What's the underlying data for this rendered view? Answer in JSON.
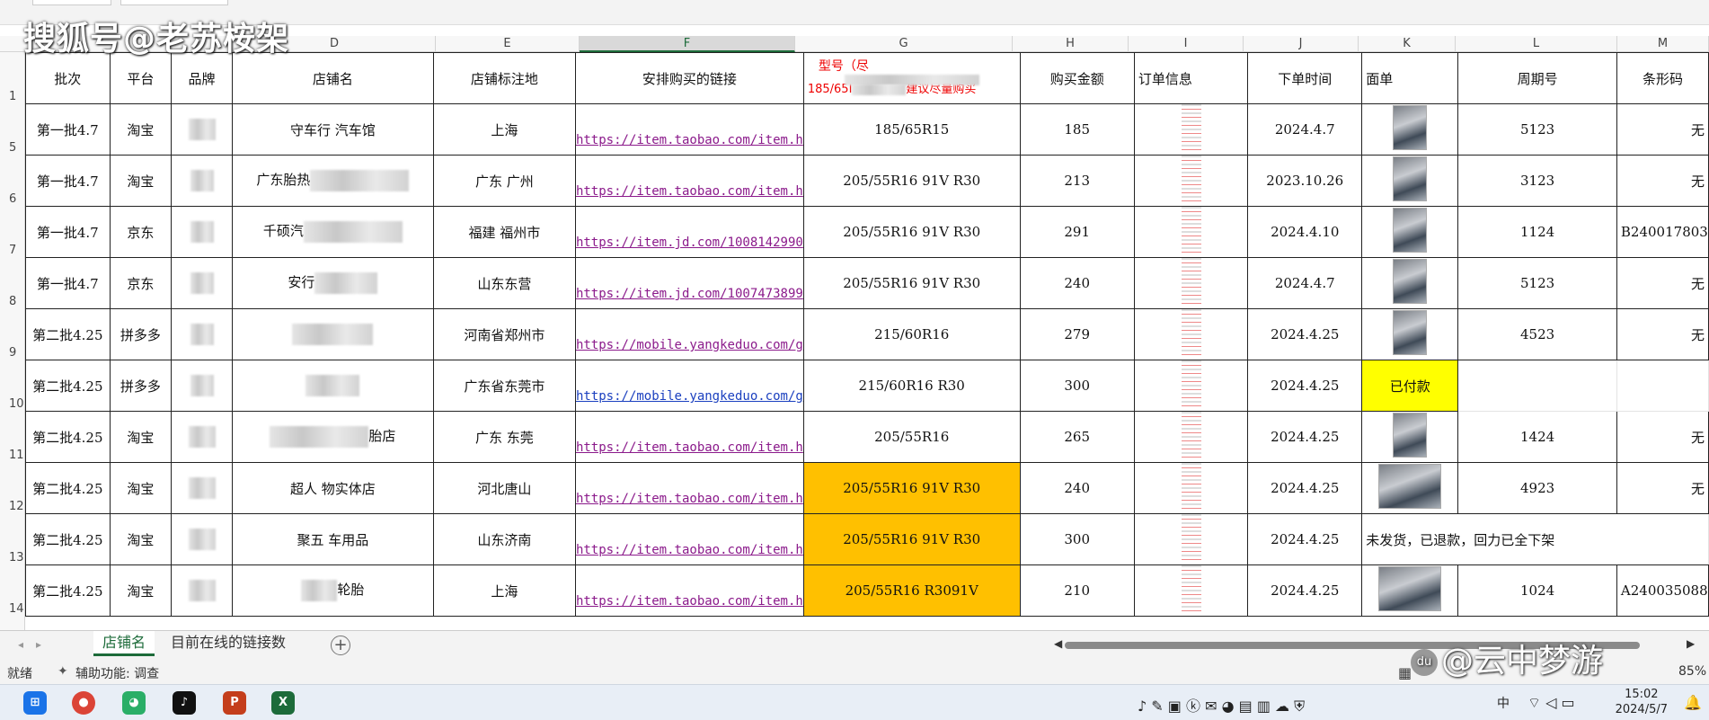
{
  "watermark_top": "搜狐号@老苏桉架",
  "watermark_bottom": "@云中梦游",
  "watermark_bottom_logo": "du",
  "columns": [
    "D",
    "E",
    "F",
    "G",
    "H",
    "I",
    "J",
    "K",
    "L",
    "M"
  ],
  "row_numbers": [
    "1",
    "5",
    "6",
    "7",
    "8",
    "9",
    "10",
    "11",
    "12",
    "13",
    "14"
  ],
  "headers": {
    "batch": "批次",
    "platform": "平台",
    "brand": "品牌",
    "shop": "店铺名",
    "location": "店铺标注地",
    "link": "安排购买的链接",
    "model_line1": "型号（尽",
    "model_line2": "185/65I",
    "model_line3": "建议尽量购买",
    "amount": "购买金额",
    "order": "订单信息",
    "time": "下单时间",
    "sheet": "面单",
    "week": "周期号",
    "barcode": "条形码"
  },
  "rows": [
    {
      "batch": "第一批4.7",
      "platform": "淘宝",
      "shop": "守车行 汽车馆",
      "location": "上海",
      "link": "https://item.taobao.com/item.h",
      "model": "185/65R15",
      "amount": "185",
      "time": "2024.4.7",
      "week": "5123",
      "barcode": "无"
    },
    {
      "batch": "第一批4.7",
      "platform": "淘宝",
      "shop": "广东胎热",
      "location": "广东 广州",
      "link": "https://item.taobao.com/item.h",
      "model": "205/55R16 91V R30",
      "amount": "213",
      "time": "2023.10.26",
      "week": "3123",
      "barcode": "无"
    },
    {
      "batch": "第一批4.7",
      "platform": "京东",
      "shop": "千硕汽",
      "location": "福建 福州市",
      "link": "https://item.jd.com/1008142990",
      "model": "205/55R16 91V R30",
      "amount": "291",
      "time": "2024.4.10",
      "week": "1124",
      "barcode": "B240017803"
    },
    {
      "batch": "第一批4.7",
      "platform": "京东",
      "shop": "安行",
      "location": "山东东营",
      "link": "https://item.jd.com/1007473899",
      "model": "205/55R16 91V R30",
      "amount": "240",
      "time": "2024.4.7",
      "week": "5123",
      "barcode": "无"
    },
    {
      "batch": "第二批4.25",
      "platform": "拼多多",
      "shop": "",
      "location": "河南省郑州市",
      "link": "https://mobile.yangkeduo.com/g",
      "model": "215/60R16",
      "amount": "279",
      "time": "2024.4.25",
      "week": "4523",
      "barcode": "无"
    },
    {
      "batch": "第二批4.25",
      "platform": "拼多多",
      "shop": "",
      "location": "广东省东莞市",
      "link": "https://mobile.yangkeduo.com/g",
      "model": "215/60R16 R30",
      "amount": "300",
      "time": "2024.4.25",
      "sheet_text": "已付款",
      "week": "",
      "barcode": ""
    },
    {
      "batch": "第二批4.25",
      "platform": "淘宝",
      "shop": "胎店",
      "location": "广东 东莞",
      "link": "https://item.taobao.com/item.h",
      "model": "205/55R16",
      "amount": "265",
      "time": "2024.4.25",
      "week": "1424",
      "barcode": "无"
    },
    {
      "batch": "第二批4.25",
      "platform": "淘宝",
      "shop": "超人 物实体店",
      "location": "河北唐山",
      "link": "https://item.taobao.com/item.h",
      "model": "205/55R16 91V R30",
      "amount": "240",
      "time": "2024.4.25",
      "week": "4923",
      "barcode": "无"
    },
    {
      "batch": "第二批4.25",
      "platform": "淘宝",
      "shop": "聚五 车用品",
      "location": "山东济南",
      "link": "https://item.taobao.com/item.h",
      "model": "205/55R16 91V R30",
      "amount": "300",
      "time": "2024.4.25",
      "sheet_text": "未发货，已退款，回力已全下架",
      "week": "",
      "barcode": ""
    },
    {
      "batch": "第二批4.25",
      "platform": "淘宝",
      "shop": "轮胎",
      "location": "上海",
      "link": "https://item.taobao.com/item.h",
      "model": "205/55R16 R3091V",
      "amount": "210",
      "time": "2024.4.25",
      "week": "1024",
      "barcode": "A240035088"
    }
  ],
  "tabs": [
    "店铺名",
    "目前在线的链接数"
  ],
  "status": {
    "ready": "就绪",
    "accessibility": "辅助功能: 调查",
    "zoom": "85%"
  },
  "taskbar": {
    "ime": "中",
    "time": "15:02",
    "date": "2024/5/7"
  },
  "colors": {
    "orange": "#ffc000",
    "yellow": "#ffff00",
    "excel_green": "#1d6b3a",
    "link_blue": "#1a3fbf",
    "link_visited": "#8b1a8b"
  }
}
